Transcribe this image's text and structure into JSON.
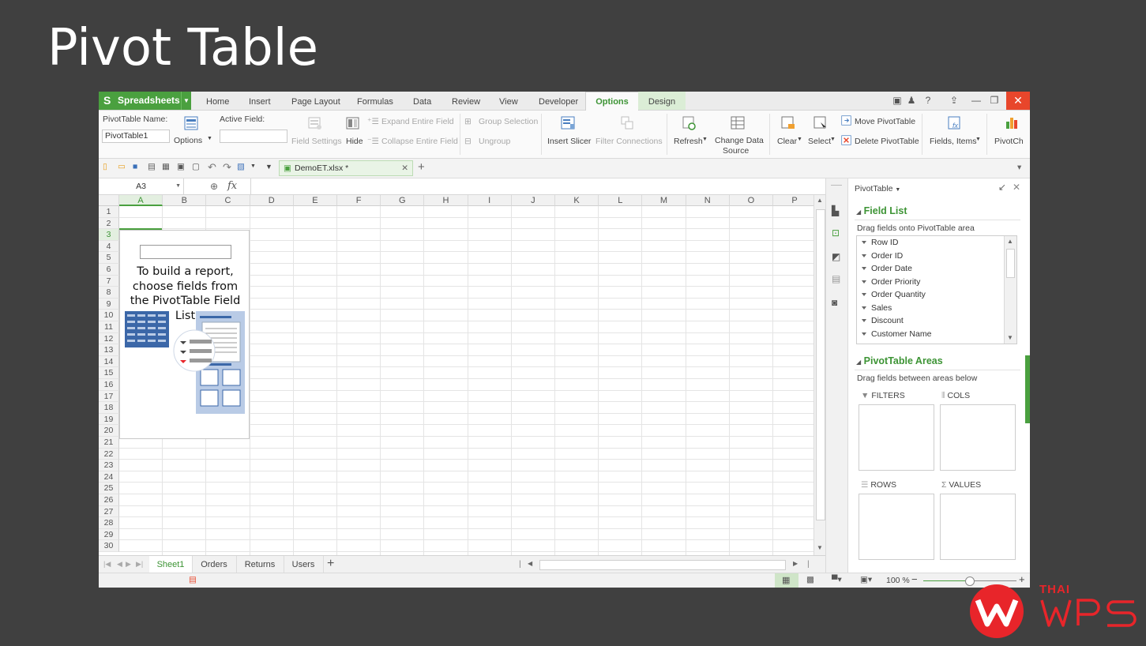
{
  "slide": {
    "title": "Pivot Table"
  },
  "app": {
    "name": "Spreadsheets",
    "tabs": [
      "Home",
      "Insert",
      "Page Layout",
      "Formulas",
      "Data",
      "Review",
      "View",
      "Developer",
      "Options",
      "Design"
    ],
    "active_tab": "Options",
    "window_controls": {
      "help": "?",
      "minimize": "—",
      "restore": "❐",
      "close": "✕"
    }
  },
  "ribbon": {
    "pivot_name_label": "PivotTable Name:",
    "pivot_name_value": "PivotTable1",
    "options": "Options",
    "active_field_label": "Active Field:",
    "field_settings": "Field Settings",
    "hide": "Hide",
    "expand_entire_field": "Expand Entire Field",
    "collapse_entire_field": "Collapse Entire Field",
    "group_selection": "Group Selection",
    "ungroup": "Ungroup",
    "insert_slicer": "Insert Slicer",
    "filter_connections": "Filter Connections",
    "refresh": "Refresh",
    "change_data_source_1": "Change Data",
    "change_data_source_2": "Source",
    "clear": "Clear",
    "select": "Select",
    "move_pivottable": "Move PivotTable",
    "delete_pivottable": "Delete PivotTable",
    "fields_items": "Fields, Items",
    "pivot_chart": "PivotCh"
  },
  "document": {
    "tab": "DemoET.xlsx *"
  },
  "formula_bar": {
    "cell_ref": "A3",
    "fx": "fx"
  },
  "grid": {
    "columns": [
      "A",
      "B",
      "C",
      "D",
      "E",
      "F",
      "G",
      "H",
      "I",
      "J",
      "K",
      "L",
      "M",
      "N",
      "O",
      "P"
    ],
    "rows": [
      "1",
      "2",
      "3",
      "4",
      "5",
      "6",
      "7",
      "8",
      "9",
      "10",
      "11",
      "12",
      "13",
      "14",
      "15",
      "16",
      "17",
      "18",
      "19",
      "20",
      "21",
      "22",
      "23",
      "24",
      "25",
      "26",
      "27",
      "28",
      "29",
      "30"
    ],
    "placeholder_lines": [
      "To build a report,",
      "choose fields from",
      "the PivotTable Field",
      "List"
    ]
  },
  "sheets": {
    "tabs": [
      "Sheet1",
      "Orders",
      "Returns",
      "Users"
    ],
    "active": "Sheet1",
    "add": "+"
  },
  "status": {
    "zoom": "100 %"
  },
  "pane": {
    "header": "PivotTable",
    "field_list_title": "Field List",
    "field_list_desc": "Drag fields onto PivotTable area",
    "fields": [
      "Row ID",
      "Order ID",
      "Order Date",
      "Order Priority",
      "Order Quantity",
      "Sales",
      "Discount",
      "Customer Name"
    ],
    "areas_title": "PivotTable Areas",
    "areas_desc": "Drag fields between areas below",
    "filters": "FILTERS",
    "cols": "COLS",
    "rows": "ROWS",
    "values": "VALUES"
  },
  "brand": {
    "thai": "THAI",
    "wps": "WPS",
    "color": "#e8252a"
  }
}
